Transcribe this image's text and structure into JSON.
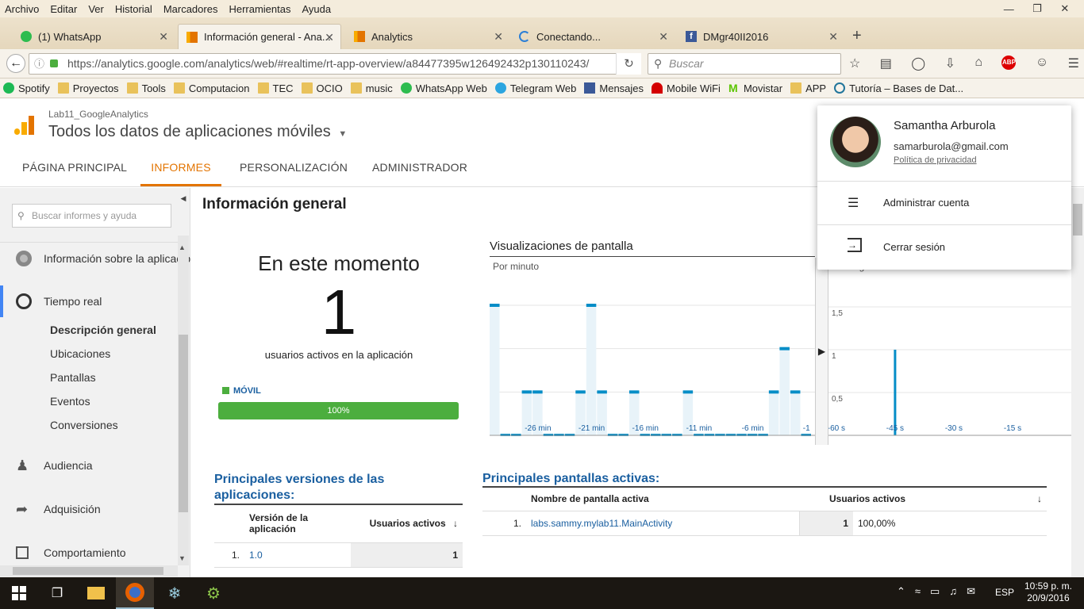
{
  "menu": [
    "Archivo",
    "Editar",
    "Ver",
    "Historial",
    "Marcadores",
    "Herramientas",
    "Ayuda"
  ],
  "tabs": [
    {
      "label": "(1) WhatsApp",
      "icon": "whatsapp-icon"
    },
    {
      "label": "Información general - Ana...",
      "icon": "analytics-icon"
    },
    {
      "label": "Analytics",
      "icon": "analytics-icon"
    },
    {
      "label": "Conectando...",
      "icon": "loading-icon"
    },
    {
      "label": "DMgr40II2016",
      "icon": "facebook-icon"
    }
  ],
  "new_tab": "+",
  "url": "https://analytics.google.com/analytics/web/#realtime/rt-app-overview/a84477395w126492432p130110243/",
  "search_placeholder": "Buscar",
  "bookmarks": [
    "Spotify",
    "Proyectos",
    "Tools",
    "Computacion",
    "TEC",
    "OCIO",
    "music",
    "WhatsApp Web",
    "Telegram Web",
    "Mensajes",
    "Mobile WiFi",
    "Movistar",
    "APP",
    "Tutoría – Bases de Dat..."
  ],
  "ga": {
    "account": "Lab11_GoogleAnalytics",
    "property": "Todos los datos de aplicaciones móviles",
    "nav": [
      "PÁGINA PRINCIPAL",
      "INFORMES",
      "PERSONALIZACIÓN",
      "ADMINISTRADOR"
    ],
    "search_placeholder": "Buscar informes y ayuda",
    "sidebar": {
      "info": "Información sobre la aplicació",
      "realtime": "Tiempo real",
      "sub": [
        "Descripción general",
        "Ubicaciones",
        "Pantallas",
        "Eventos",
        "Conversiones"
      ],
      "audience": "Audiencia",
      "acquisition": "Adquisición",
      "behavior": "Comportamiento"
    },
    "page_title": "Información general",
    "now_title": "En este momento",
    "active_users": "1",
    "active_label": "usuarios activos en la aplicación",
    "device_label": "MÓVIL",
    "device_pct": "100%",
    "device_fraction": 1.0,
    "chart_title": "Visualizaciones de pantalla",
    "chart_sub": "Por minuto",
    "chart2_sub": "Por segundo",
    "versions_title": "Principales versiones de las aplicaciones:",
    "versions_cols": [
      "Versión de la aplicación",
      "Usuarios activos"
    ],
    "versions_rows": [
      {
        "n": "1.",
        "version": "1.0",
        "users": "1"
      }
    ],
    "screens_title": "Principales pantallas activas:",
    "screens_cols": [
      "Nombre de pantalla activa",
      "Usuarios activos"
    ],
    "screens_rows": [
      {
        "n": "1.",
        "name": "labs.sammy.mylab11.MainActivity",
        "users": "1",
        "pct": "100,00%"
      }
    ]
  },
  "chart_data": [
    {
      "type": "bar",
      "title": "Visualizaciones de pantalla",
      "subtitle": "Por minuto",
      "categories": [
        "-30",
        "-29",
        "-28",
        "-27",
        "-26",
        "-25",
        "-24",
        "-23",
        "-22",
        "-21",
        "-20",
        "-19",
        "-18",
        "-17",
        "-16",
        "-15",
        "-14",
        "-13",
        "-12",
        "-11",
        "-10",
        "-9",
        "-8",
        "-7",
        "-6",
        "-5",
        "-4",
        "-3",
        "-2",
        "-1"
      ],
      "x_tick_labels": [
        "-26 min",
        "-21 min",
        "-16 min",
        "-11 min",
        "-6 min",
        "-1"
      ],
      "values": [
        3,
        0,
        0,
        1,
        1,
        0,
        0,
        0,
        1,
        3,
        1,
        0,
        0,
        1,
        0,
        0,
        0,
        0,
        1,
        0,
        0,
        0,
        0,
        0,
        0,
        0,
        1,
        2,
        1,
        0
      ],
      "y_ticks": [
        "1",
        "2",
        "3"
      ],
      "ylim": [
        0,
        3
      ]
    },
    {
      "type": "bar",
      "subtitle": "Por segundo",
      "x_tick_labels": [
        "-60 s",
        "-45 s",
        "-30 s",
        "-15 s"
      ],
      "y_ticks": [
        "0,5",
        "1",
        "1,5"
      ],
      "ylim": [
        0,
        1.5
      ],
      "x": [
        -45
      ],
      "values": [
        1
      ]
    }
  ],
  "account_popup": {
    "name": "Samantha Arburola",
    "email": "samarburola@gmail.com",
    "privacy": "Política de privacidad",
    "manage": "Administrar cuenta",
    "logout": "Cerrar sesión"
  },
  "taskbar": {
    "lang": "ESP",
    "time": "10:59 p. m.",
    "date": "20/9/2016"
  },
  "colors": {
    "accent": "#e37400",
    "link": "#1a5fa0",
    "bar": "#058dc7",
    "bar_bg": "#e8f3f9",
    "green": "#4cae3e"
  }
}
